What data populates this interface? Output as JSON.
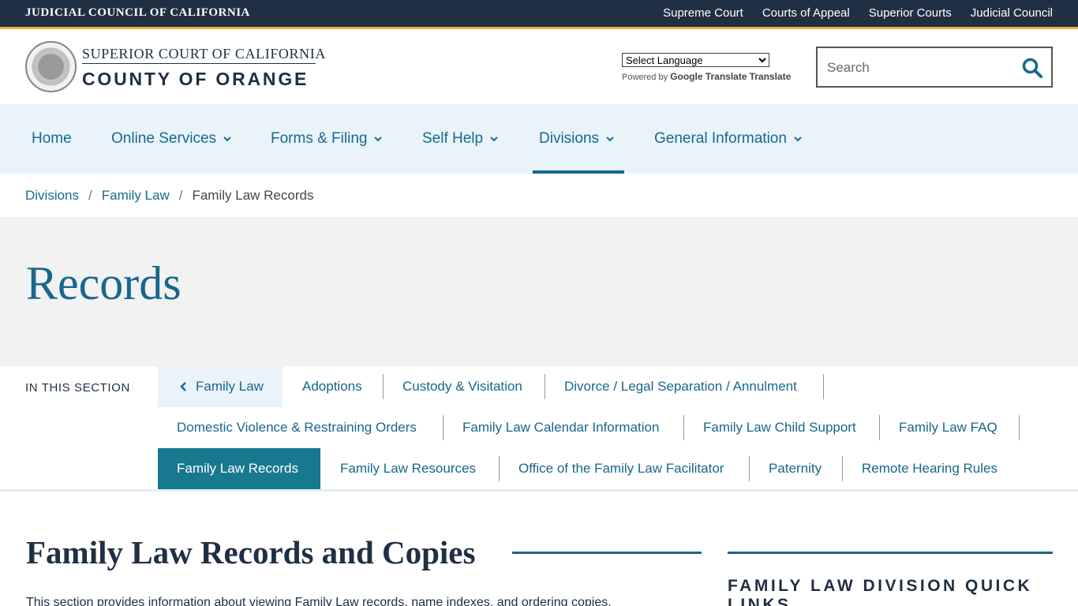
{
  "topbar": {
    "brand": "JUDICIAL COUNCIL OF CALIFORNIA",
    "links": [
      "Supreme Court",
      "Courts of Appeal",
      "Superior Courts",
      "Judicial Council"
    ]
  },
  "header": {
    "court_line1": "SUPERIOR COURT OF CALIFORNIA",
    "court_line2": "COUNTY OF ORANGE",
    "translate_select": "Select Language",
    "powered_by": "Powered by",
    "google_translate": "Google Translate",
    "translate_word": "Translate",
    "search_placeholder": "Search"
  },
  "nav": {
    "home": "Home",
    "online_services": "Online Services",
    "forms_filing": "Forms & Filing",
    "self_help": "Self Help",
    "divisions": "Divisions",
    "general_information": "General Information"
  },
  "breadcrumb": {
    "items": [
      "Divisions",
      "Family Law",
      "Family Law Records"
    ],
    "separator": "/"
  },
  "hero": {
    "title": "Records"
  },
  "section_nav": {
    "label": "IN THIS SECTION",
    "back": "Family Law",
    "items": [
      "Adoptions",
      "Custody & Visitation",
      "Divorce / Legal Separation / Annulment",
      "Domestic Violence & Restraining Orders",
      "Family Law Calendar Information",
      "Family Law Child Support",
      "Family Law FAQ",
      "Family Law Records",
      "Family Law Resources",
      "Office of the Family Law Facilitator",
      "Paternity",
      "Remote Hearing Rules"
    ],
    "active": "Family Law Records"
  },
  "content": {
    "title": "Family Law Records and Copies",
    "intro": "This section provides information about viewing Family Law records, name indexes, and ordering copies."
  },
  "sidebar": {
    "title": "FAMILY LAW DIVISION QUICK LINKS"
  },
  "colors": {
    "topbar_bg": "#1f2f44",
    "accent_gold": "#e9b43a",
    "link_blue": "#17678c",
    "nav_bg": "#e9f3f9",
    "active_teal": "#17798f"
  }
}
